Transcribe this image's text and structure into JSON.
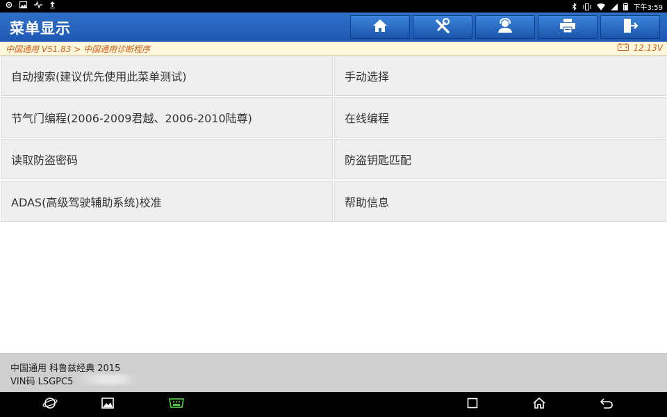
{
  "status_bar": {
    "time": "下午3:59"
  },
  "header": {
    "title": "菜单显示"
  },
  "toolbar": [
    {
      "name": "home-button",
      "icon": "home-icon"
    },
    {
      "name": "diagnose-tools-button",
      "icon": "tools-icon"
    },
    {
      "name": "support-button",
      "icon": "headset-icon"
    },
    {
      "name": "print-button",
      "icon": "printer-icon"
    },
    {
      "name": "exit-button",
      "icon": "exit-icon"
    }
  ],
  "breadcrumb": {
    "path": "中国通用 V51.83 > 中国通用诊断程序",
    "voltage": "12.13V"
  },
  "menu": {
    "items": [
      {
        "label": "自动搜索(建议优先使用此菜单测试)"
      },
      {
        "label": "手动选择"
      },
      {
        "label": "节气门编程(2006-2009君越、2006-2010陆尊)"
      },
      {
        "label": "在线编程"
      },
      {
        "label": "读取防盗密码"
      },
      {
        "label": "防盗钥匙匹配"
      },
      {
        "label": "ADAS(高级驾驶辅助系统)校准"
      },
      {
        "label": "帮助信息"
      }
    ]
  },
  "footer": {
    "vehicle": "中国通用 科鲁兹经典 2015",
    "vin": "VIN码 LSGPC5"
  },
  "colors": {
    "header": "#1e59b4",
    "accent_text": "#d0601a",
    "menu_bg": "#efefef",
    "footer_bg": "#cfcfcf"
  }
}
